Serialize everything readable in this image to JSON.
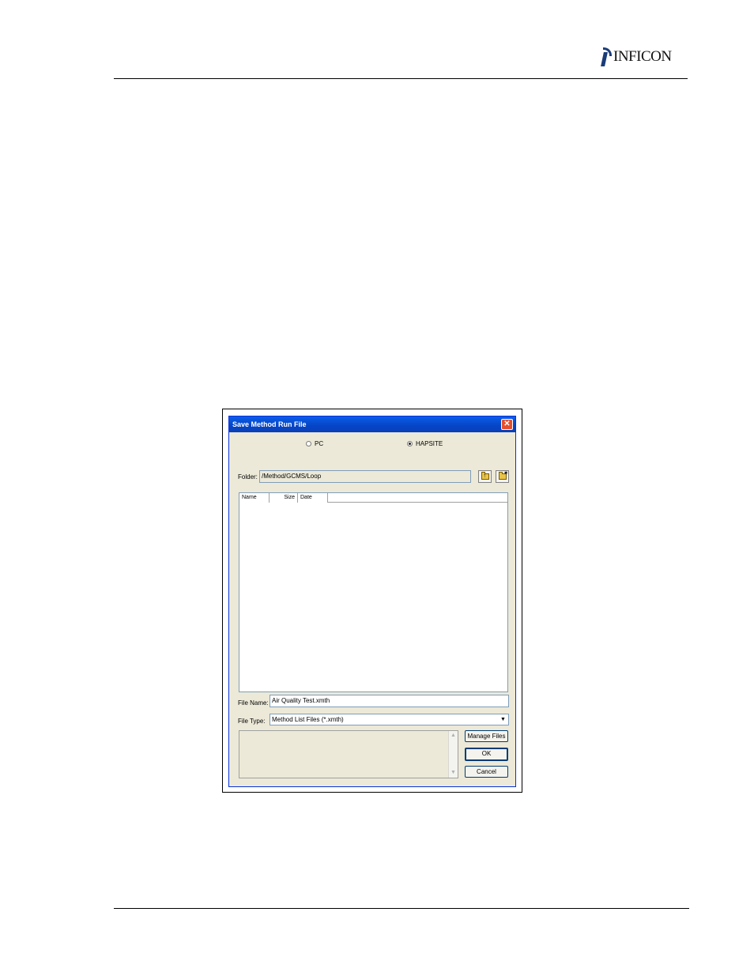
{
  "header": {
    "brand": "INFICON"
  },
  "dialog": {
    "title": "Save Method Run File",
    "close_glyph": "✕",
    "location": {
      "options": [
        {
          "label": "PC",
          "selected": false
        },
        {
          "label": "HAPSITE",
          "selected": true
        }
      ]
    },
    "folder": {
      "label": "Folder:",
      "value": "/Method/GCMS/Loop"
    },
    "file_list": {
      "columns": [
        "Name",
        "Size",
        "Date"
      ],
      "rows": []
    },
    "file_name": {
      "label": "File Name:",
      "value": "Air Quality Test.xmth"
    },
    "file_type": {
      "label": "File Type:",
      "value": "Method List Files (*.xmth)"
    },
    "buttons": {
      "manage": "Manage Files",
      "ok": "OK",
      "cancel": "Cancel"
    },
    "icons": {
      "folder_up": "folder-up-icon",
      "new_folder": "new-folder-icon",
      "close": "close-icon"
    },
    "colors": {
      "titlebar": "#0545c6",
      "face": "#ece9d8",
      "close": "#e4502c"
    }
  }
}
